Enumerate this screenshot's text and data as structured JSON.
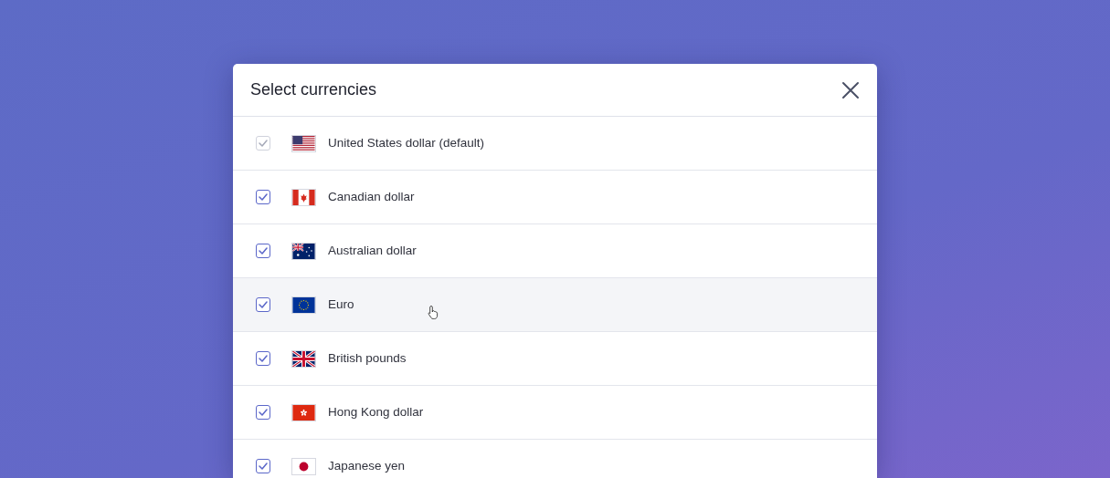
{
  "dialog": {
    "title": "Select currencies"
  },
  "currencies": [
    {
      "name": "United States dollar (default)",
      "kind": "us",
      "checked": true,
      "disabled": true,
      "highlighted": false
    },
    {
      "name": "Canadian dollar",
      "kind": "ca",
      "checked": true,
      "disabled": false,
      "highlighted": false
    },
    {
      "name": "Australian dollar",
      "kind": "au",
      "checked": true,
      "disabled": false,
      "highlighted": false
    },
    {
      "name": "Euro",
      "kind": "eu",
      "checked": true,
      "disabled": false,
      "highlighted": true
    },
    {
      "name": "British pounds",
      "kind": "gb",
      "checked": true,
      "disabled": false,
      "highlighted": false
    },
    {
      "name": "Hong Kong dollar",
      "kind": "hk",
      "checked": true,
      "disabled": false,
      "highlighted": false
    },
    {
      "name": "Japanese yen",
      "kind": "jp",
      "checked": true,
      "disabled": false,
      "highlighted": false
    }
  ]
}
